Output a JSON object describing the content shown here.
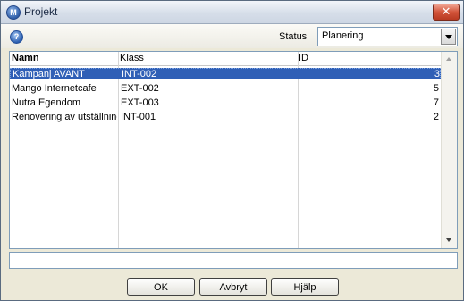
{
  "window": {
    "title": "Projekt",
    "app_icon": "M"
  },
  "toolbar": {
    "help_icon": "?",
    "status_label": "Status",
    "status_value": "Planering"
  },
  "list": {
    "columns": [
      "Namn",
      "Klass",
      "ID"
    ],
    "rows": [
      {
        "name": "Kampanj AVANT",
        "klass": "INT-002",
        "id": "3"
      },
      {
        "name": "Mango Internetcafe",
        "klass": "EXT-002",
        "id": "5"
      },
      {
        "name": "Nutra Egendom",
        "klass": "EXT-003",
        "id": "7"
      },
      {
        "name": "Renovering  av utställning",
        "klass": "INT-001",
        "id": "2"
      }
    ]
  },
  "info_field": {
    "value": ""
  },
  "buttons": {
    "ok": "OK",
    "cancel": "Avbryt",
    "help": "Hjälp"
  },
  "colors": {
    "selection": "#2f5fb6",
    "close": "#d2543a"
  }
}
